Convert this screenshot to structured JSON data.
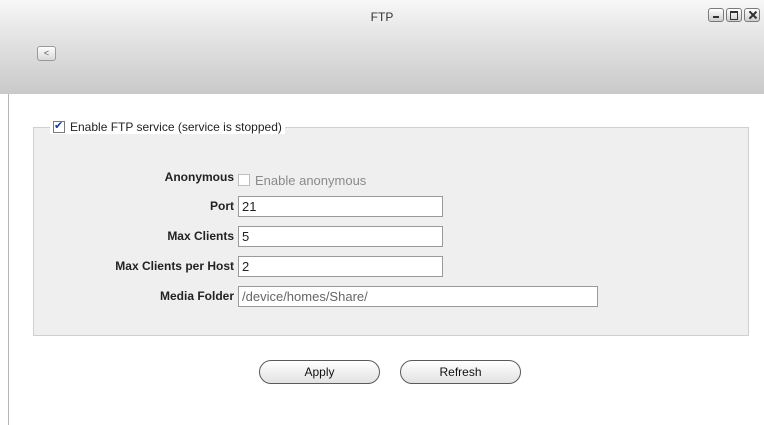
{
  "window": {
    "title": "FTP"
  },
  "toolbar": {
    "back_label": "<"
  },
  "ftp": {
    "enable_label": "Enable FTP service (service is stopped)",
    "enable_checked": true,
    "anonymous_label": "Anonymous",
    "anonymous_option": "Enable anonymous",
    "anonymous_checked": false,
    "port_label": "Port",
    "port_value": "21",
    "max_clients_label": "Max Clients",
    "max_clients_value": "5",
    "max_per_host_label": "Max Clients per Host",
    "max_per_host_value": "2",
    "media_folder_label": "Media Folder",
    "media_folder_value": "/device/homes/Share/"
  },
  "actions": {
    "apply_label": "Apply",
    "refresh_label": "Refresh"
  }
}
